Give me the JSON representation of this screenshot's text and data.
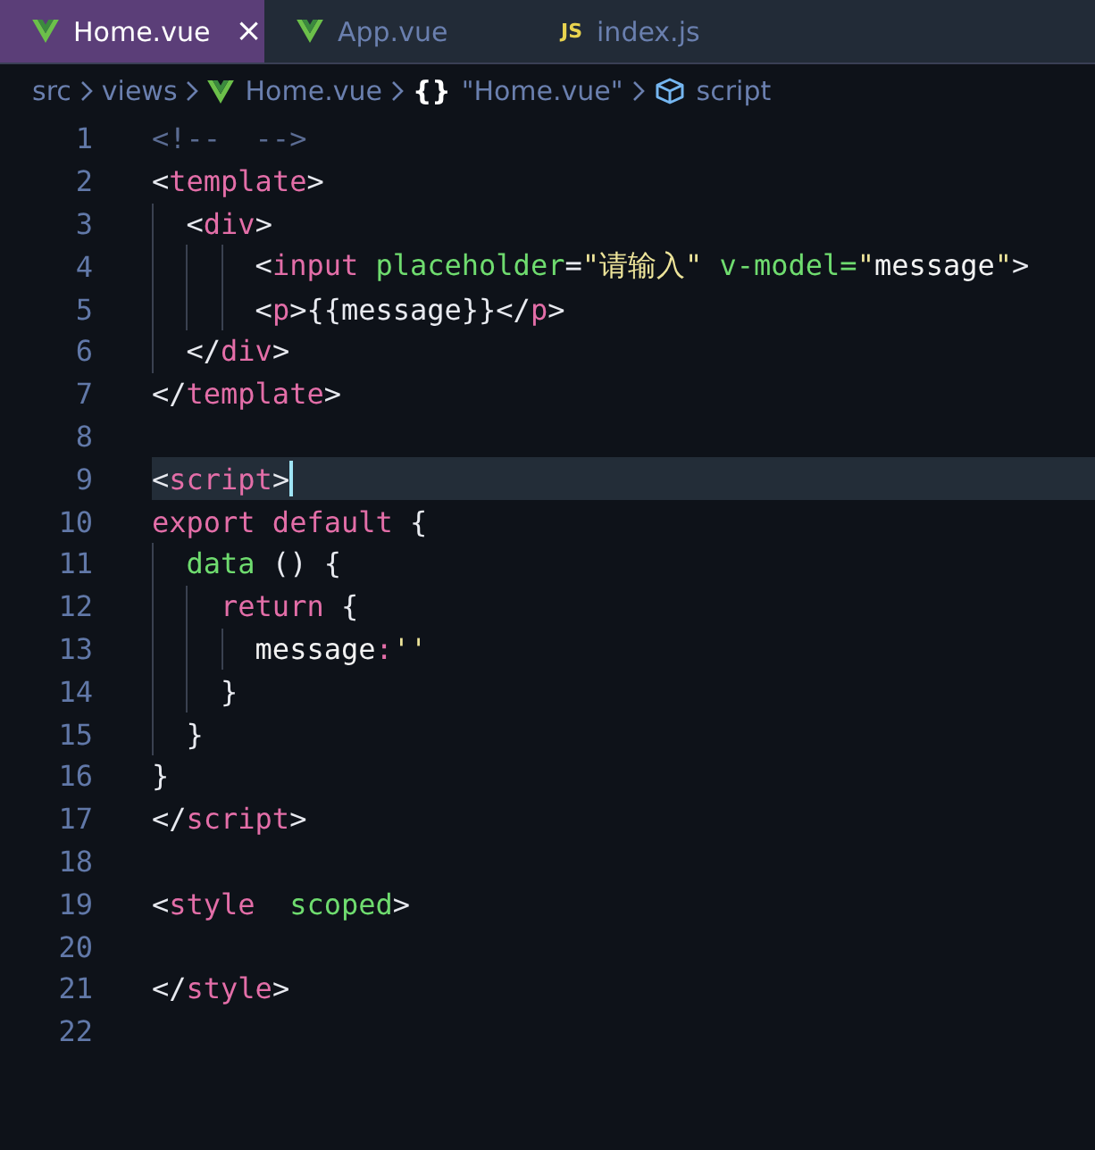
{
  "tabs": [
    {
      "label": "Home.vue",
      "kind": "vue",
      "selected": true,
      "close": "×"
    },
    {
      "label": "App.vue",
      "kind": "vue",
      "selected": false
    },
    {
      "label": "index.js",
      "kind": "js",
      "icon_text": "JS",
      "selected": false
    }
  ],
  "breadcrumb": [
    {
      "kind": "text",
      "label": "src"
    },
    {
      "kind": "text",
      "label": "views"
    },
    {
      "kind": "vue",
      "label": "Home.vue"
    },
    {
      "kind": "object",
      "label": "\"Home.vue\"",
      "glyph": "{}"
    },
    {
      "kind": "module",
      "label": "script"
    }
  ],
  "lines": [
    {
      "number": "1",
      "current": false,
      "tokens": [
        {
          "kind": "comment",
          "text": "<!--  -->"
        }
      ]
    },
    {
      "number": "2",
      "current": false,
      "tokens": [
        {
          "kind": "punct",
          "text": "<"
        },
        {
          "kind": "tag",
          "text": "template"
        },
        {
          "kind": "punct",
          "text": ">"
        }
      ]
    },
    {
      "number": "3",
      "current": false,
      "tokens": [
        {
          "kind": "punct",
          "text": "  <"
        },
        {
          "kind": "tag",
          "text": "div"
        },
        {
          "kind": "punct",
          "text": ">"
        }
      ]
    },
    {
      "number": "4",
      "current": false,
      "tokens": [
        {
          "kind": "punct",
          "text": "      <"
        },
        {
          "kind": "tag",
          "text": "input"
        },
        {
          "kind": "attr",
          "text": " placeholder"
        },
        {
          "kind": "punct",
          "text": "="
        },
        {
          "kind": "string",
          "text": "\"请输入\""
        },
        {
          "kind": "attr",
          "text": " v-model="
        },
        {
          "kind": "string",
          "text": "\""
        },
        {
          "kind": "plain",
          "text": "message"
        },
        {
          "kind": "string",
          "text": "\""
        },
        {
          "kind": "punct",
          "text": ">"
        }
      ]
    },
    {
      "number": "5",
      "current": false,
      "tokens": [
        {
          "kind": "punct",
          "text": "      <"
        },
        {
          "kind": "tag",
          "text": "p"
        },
        {
          "kind": "punct",
          "text": ">{{message}}</"
        },
        {
          "kind": "tag",
          "text": "p"
        },
        {
          "kind": "punct",
          "text": ">"
        }
      ]
    },
    {
      "number": "6",
      "current": false,
      "tokens": [
        {
          "kind": "punct",
          "text": "  </"
        },
        {
          "kind": "tag",
          "text": "div"
        },
        {
          "kind": "punct",
          "text": ">"
        }
      ]
    },
    {
      "number": "7",
      "current": false,
      "tokens": [
        {
          "kind": "punct",
          "text": "</"
        },
        {
          "kind": "tag",
          "text": "template"
        },
        {
          "kind": "punct",
          "text": ">"
        }
      ]
    },
    {
      "number": "8",
      "current": false
    },
    {
      "number": "9",
      "current": true,
      "tokens": [
        {
          "kind": "punct",
          "text": "<"
        },
        {
          "kind": "tag",
          "text": "script"
        },
        {
          "kind": "punct",
          "text": ">"
        }
      ]
    },
    {
      "number": "10",
      "current": false,
      "tokens": [
        {
          "kind": "keyword",
          "text": "export default"
        },
        {
          "kind": "punct",
          "text": " {"
        }
      ]
    },
    {
      "number": "11",
      "current": false,
      "tokens": [
        {
          "kind": "attr",
          "text": "  data"
        },
        {
          "kind": "punct",
          "text": " () {"
        }
      ]
    },
    {
      "number": "12",
      "current": false,
      "tokens": [
        {
          "kind": "keyword",
          "text": "    return"
        },
        {
          "kind": "punct",
          "text": " {"
        }
      ]
    },
    {
      "number": "13",
      "current": false,
      "tokens": [
        {
          "kind": "plain",
          "text": "      message"
        },
        {
          "kind": "keyword",
          "text": ":"
        },
        {
          "kind": "string",
          "text": "''"
        }
      ]
    },
    {
      "number": "14",
      "current": false,
      "tokens": [
        {
          "kind": "punct",
          "text": "    }"
        }
      ]
    },
    {
      "number": "15",
      "current": false,
      "tokens": [
        {
          "kind": "punct",
          "text": "  }"
        }
      ]
    },
    {
      "number": "16",
      "current": false,
      "tokens": [
        {
          "kind": "punct",
          "text": "}"
        }
      ]
    },
    {
      "number": "17",
      "current": false,
      "tokens": [
        {
          "kind": "punct",
          "text": "</"
        },
        {
          "kind": "tag",
          "text": "script"
        },
        {
          "kind": "punct",
          "text": ">"
        }
      ]
    },
    {
      "number": "18",
      "current": false
    },
    {
      "number": "19",
      "current": false,
      "tokens": [
        {
          "kind": "punct",
          "text": "<"
        },
        {
          "kind": "tag",
          "text": "style"
        },
        {
          "kind": "attr",
          "text": "  scoped"
        },
        {
          "kind": "punct",
          "text": ">"
        }
      ]
    },
    {
      "number": "20",
      "current": false
    },
    {
      "number": "21",
      "current": false,
      "tokens": [
        {
          "kind": "punct",
          "text": "</"
        },
        {
          "kind": "tag",
          "text": "style"
        },
        {
          "kind": "punct",
          "text": ">"
        }
      ]
    },
    {
      "number": "22",
      "current": false
    }
  ]
}
